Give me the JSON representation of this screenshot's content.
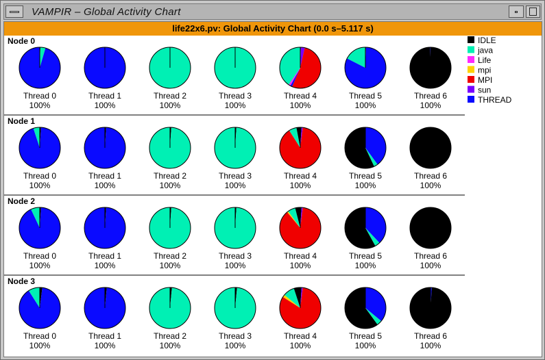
{
  "window": {
    "title": "VAMPIR – Global Activity Chart"
  },
  "chart_data": {
    "type": "pie",
    "title": "life22x6.pv: Global Activity Chart (0.0 s–5.117 s)",
    "legend": {
      "placement": "top-right",
      "entries": [
        {
          "name": "IDLE",
          "color": "#000000"
        },
        {
          "name": "java",
          "color": "#00f0b4"
        },
        {
          "name": "Life",
          "color": "#ff28ff"
        },
        {
          "name": "mpi",
          "color": "#ffd200"
        },
        {
          "name": "MPI",
          "color": "#f00000"
        },
        {
          "name": "sun",
          "color": "#7800ff"
        },
        {
          "name": "THREAD",
          "color": "#0a0aff"
        }
      ]
    },
    "nodes": [
      {
        "label": "Node 0",
        "threads": [
          {
            "label": "Thread 0",
            "percent": "100%",
            "slices": [
              {
                "name": "IDLE",
                "value": 0.5
              },
              {
                "name": "java",
                "value": 4
              },
              {
                "name": "THREAD",
                "value": 95.5
              }
            ]
          },
          {
            "label": "Thread 1",
            "percent": "100%",
            "slices": [
              {
                "name": "IDLE",
                "value": 0.3
              },
              {
                "name": "THREAD",
                "value": 99.7
              }
            ]
          },
          {
            "label": "Thread 2",
            "percent": "100%",
            "slices": [
              {
                "name": "IDLE",
                "value": 0.3
              },
              {
                "name": "java",
                "value": 99.7
              }
            ]
          },
          {
            "label": "Thread 3",
            "percent": "100%",
            "slices": [
              {
                "name": "IDLE",
                "value": 0.3
              },
              {
                "name": "java",
                "value": 99.7
              }
            ]
          },
          {
            "label": "Thread 4",
            "percent": "100%",
            "slices": [
              {
                "name": "IDLE",
                "value": 0.5
              },
              {
                "name": "sun",
                "value": 3
              },
              {
                "name": "MPI",
                "value": 53
              },
              {
                "name": "THREAD",
                "value": 1.5
              },
              {
                "name": "Life",
                "value": 1.5
              },
              {
                "name": "java",
                "value": 40.5
              }
            ]
          },
          {
            "label": "Thread 5",
            "percent": "100%",
            "slices": [
              {
                "name": "IDLE",
                "value": 0.5
              },
              {
                "name": "THREAD",
                "value": 82
              },
              {
                "name": "java",
                "value": 17.5
              }
            ]
          },
          {
            "label": "Thread 6",
            "percent": "100%",
            "slices": [
              {
                "name": "IDLE",
                "value": 99.5
              },
              {
                "name": "THREAD",
                "value": 0.5
              }
            ]
          }
        ]
      },
      {
        "label": "Node 1",
        "threads": [
          {
            "label": "Thread 0",
            "percent": "100%",
            "slices": [
              {
                "name": "IDLE",
                "value": 1
              },
              {
                "name": "THREAD",
                "value": 94
              },
              {
                "name": "java",
                "value": 5
              }
            ]
          },
          {
            "label": "Thread 1",
            "percent": "100%",
            "slices": [
              {
                "name": "IDLE",
                "value": 1
              },
              {
                "name": "THREAD",
                "value": 99
              }
            ]
          },
          {
            "label": "Thread 2",
            "percent": "100%",
            "slices": [
              {
                "name": "IDLE",
                "value": 1
              },
              {
                "name": "java",
                "value": 99
              }
            ]
          },
          {
            "label": "Thread 3",
            "percent": "100%",
            "slices": [
              {
                "name": "IDLE",
                "value": 1
              },
              {
                "name": "java",
                "value": 99
              }
            ]
          },
          {
            "label": "Thread 4",
            "percent": "100%",
            "slices": [
              {
                "name": "IDLE",
                "value": 1
              },
              {
                "name": "sun",
                "value": 1
              },
              {
                "name": "MPI",
                "value": 89
              },
              {
                "name": "java",
                "value": 6
              },
              {
                "name": "IDLE",
                "value": 3
              }
            ]
          },
          {
            "label": "Thread 5",
            "percent": "100%",
            "slices": [
              {
                "name": "THREAD",
                "value": 40
              },
              {
                "name": "java",
                "value": 3
              },
              {
                "name": "IDLE",
                "value": 57
              }
            ]
          },
          {
            "label": "Thread 6",
            "percent": "100%",
            "slices": [
              {
                "name": "IDLE",
                "value": 100
              }
            ]
          }
        ]
      },
      {
        "label": "Node 2",
        "threads": [
          {
            "label": "Thread 0",
            "percent": "100%",
            "slices": [
              {
                "name": "IDLE",
                "value": 1
              },
              {
                "name": "THREAD",
                "value": 92
              },
              {
                "name": "java",
                "value": 7
              }
            ]
          },
          {
            "label": "Thread 1",
            "percent": "100%",
            "slices": [
              {
                "name": "IDLE",
                "value": 1
              },
              {
                "name": "THREAD",
                "value": 99
              }
            ]
          },
          {
            "label": "Thread 2",
            "percent": "100%",
            "slices": [
              {
                "name": "IDLE",
                "value": 1
              },
              {
                "name": "java",
                "value": 99
              }
            ]
          },
          {
            "label": "Thread 3",
            "percent": "100%",
            "slices": [
              {
                "name": "IDLE",
                "value": 1
              },
              {
                "name": "java",
                "value": 99
              }
            ]
          },
          {
            "label": "Thread 4",
            "percent": "100%",
            "slices": [
              {
                "name": "IDLE",
                "value": 1
              },
              {
                "name": "sun",
                "value": 1
              },
              {
                "name": "MPI",
                "value": 87
              },
              {
                "name": "mpi",
                "value": 1
              },
              {
                "name": "java",
                "value": 6
              },
              {
                "name": "IDLE",
                "value": 4
              }
            ]
          },
          {
            "label": "Thread 5",
            "percent": "100%",
            "slices": [
              {
                "name": "THREAD",
                "value": 38
              },
              {
                "name": "java",
                "value": 4
              },
              {
                "name": "IDLE",
                "value": 58
              }
            ]
          },
          {
            "label": "Thread 6",
            "percent": "100%",
            "slices": [
              {
                "name": "IDLE",
                "value": 100
              }
            ]
          }
        ]
      },
      {
        "label": "Node 3",
        "threads": [
          {
            "label": "Thread 0",
            "percent": "100%",
            "slices": [
              {
                "name": "IDLE",
                "value": 2
              },
              {
                "name": "THREAD",
                "value": 89
              },
              {
                "name": "java",
                "value": 9
              }
            ]
          },
          {
            "label": "Thread 1",
            "percent": "100%",
            "slices": [
              {
                "name": "IDLE",
                "value": 1.5
              },
              {
                "name": "THREAD",
                "value": 98.5
              }
            ]
          },
          {
            "label": "Thread 2",
            "percent": "100%",
            "slices": [
              {
                "name": "IDLE",
                "value": 1.5
              },
              {
                "name": "java",
                "value": 98.5
              }
            ]
          },
          {
            "label": "Thread 3",
            "percent": "100%",
            "slices": [
              {
                "name": "IDLE",
                "value": 1.5
              },
              {
                "name": "java",
                "value": 98.5
              }
            ]
          },
          {
            "label": "Thread 4",
            "percent": "100%",
            "slices": [
              {
                "name": "IDLE",
                "value": 1
              },
              {
                "name": "sun",
                "value": 1
              },
              {
                "name": "MPI",
                "value": 82
              },
              {
                "name": "mpi",
                "value": 2
              },
              {
                "name": "java",
                "value": 9
              },
              {
                "name": "IDLE",
                "value": 5
              }
            ]
          },
          {
            "label": "Thread 5",
            "percent": "100%",
            "slices": [
              {
                "name": "THREAD",
                "value": 36
              },
              {
                "name": "java",
                "value": 4
              },
              {
                "name": "IDLE",
                "value": 60
              }
            ]
          },
          {
            "label": "Thread 6",
            "percent": "100%",
            "slices": [
              {
                "name": "THREAD",
                "value": 1
              },
              {
                "name": "IDLE",
                "value": 99
              }
            ]
          }
        ]
      }
    ]
  }
}
